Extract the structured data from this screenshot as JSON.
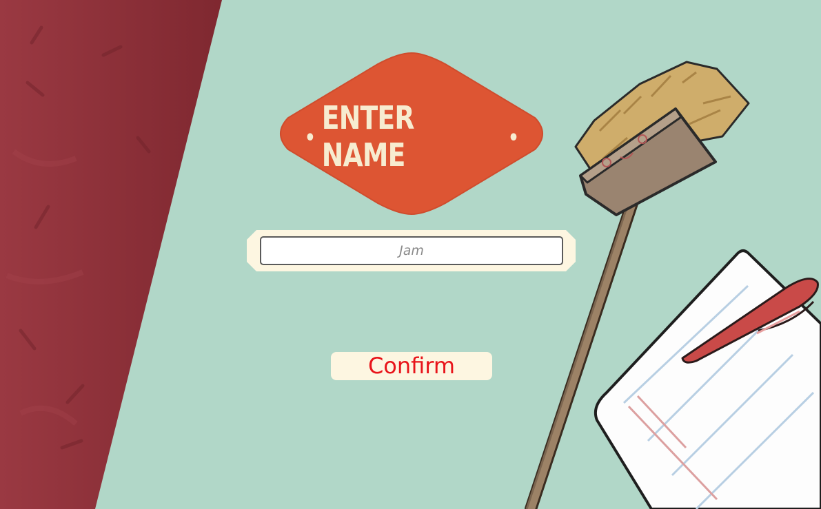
{
  "title": {
    "bullet": "•",
    "text": "ENTER NAME"
  },
  "name_input": {
    "placeholder": "Jam",
    "value": ""
  },
  "confirm_label": "Confirm",
  "colors": {
    "background": "#b1d7c8",
    "curtain": "#8a2d36",
    "badge": "#dd5533",
    "badge_text": "#f7ecd0",
    "frame": "#fdf6e1",
    "confirm_text": "#e8141a"
  },
  "decor": {
    "left_panel": "red-curtain-panel",
    "broom": "broom-icon",
    "notepad": "notepad-icon",
    "pen": "pen-icon"
  }
}
